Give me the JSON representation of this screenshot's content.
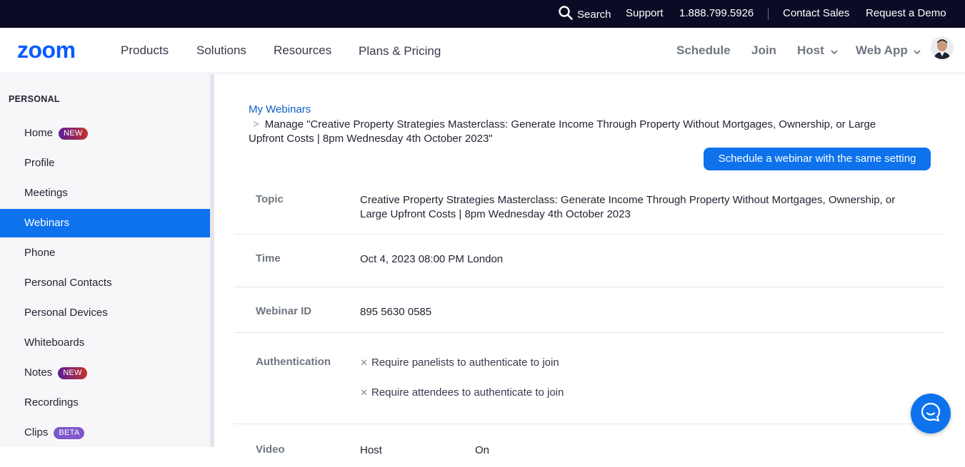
{
  "topbar": {
    "search": "Search",
    "support": "Support",
    "phone": "1.888.799.5926",
    "contact_sales": "Contact Sales",
    "request_demo": "Request a Demo"
  },
  "nav": {
    "logo": "zoom",
    "products": "Products",
    "solutions": "Solutions",
    "resources": "Resources",
    "plans": "Plans & Pricing",
    "schedule": "Schedule",
    "join": "Join",
    "host": "Host",
    "web_app": "Web App"
  },
  "sidebar": {
    "section": "PERSONAL",
    "items": [
      {
        "label": "Home",
        "badge": "NEW"
      },
      {
        "label": "Profile"
      },
      {
        "label": "Meetings"
      },
      {
        "label": "Webinars",
        "active": true
      },
      {
        "label": "Phone"
      },
      {
        "label": "Personal Contacts"
      },
      {
        "label": "Personal Devices"
      },
      {
        "label": "Whiteboards"
      },
      {
        "label": "Notes",
        "badge": "NEW"
      },
      {
        "label": "Recordings"
      },
      {
        "label": "Clips",
        "badge": "BETA"
      }
    ]
  },
  "breadcrumb": {
    "parent": "My Webinars",
    "separator": ">",
    "current": "Manage \"Creative Property Strategies Masterclass: Generate Income Through Property Without Mortgages, Ownership, or Large Upfront Costs | 8pm Wednesday 4th October 2023\""
  },
  "actions": {
    "schedule_same": "Schedule a webinar with the same setting"
  },
  "details": {
    "topic_label": "Topic",
    "topic_value": "Creative Property Strategies Masterclass: Generate Income Through Property Without Mortgages, Ownership, or Large Upfront Costs | 8pm Wednesday 4th October 2023",
    "time_label": "Time",
    "time_value": "Oct 4, 2023 08:00 PM London",
    "id_label": "Webinar ID",
    "id_value": "895 5630 0585",
    "auth_label": "Authentication",
    "auth_panelists": "Require panelists to authenticate to join",
    "auth_attendees": "Require attendees to authenticate to join",
    "video_label": "Video",
    "video_host": "Host",
    "video_host_value": "On"
  },
  "colors": {
    "brand_blue": "#0e72ed",
    "topbar_bg": "#0b0b26"
  }
}
